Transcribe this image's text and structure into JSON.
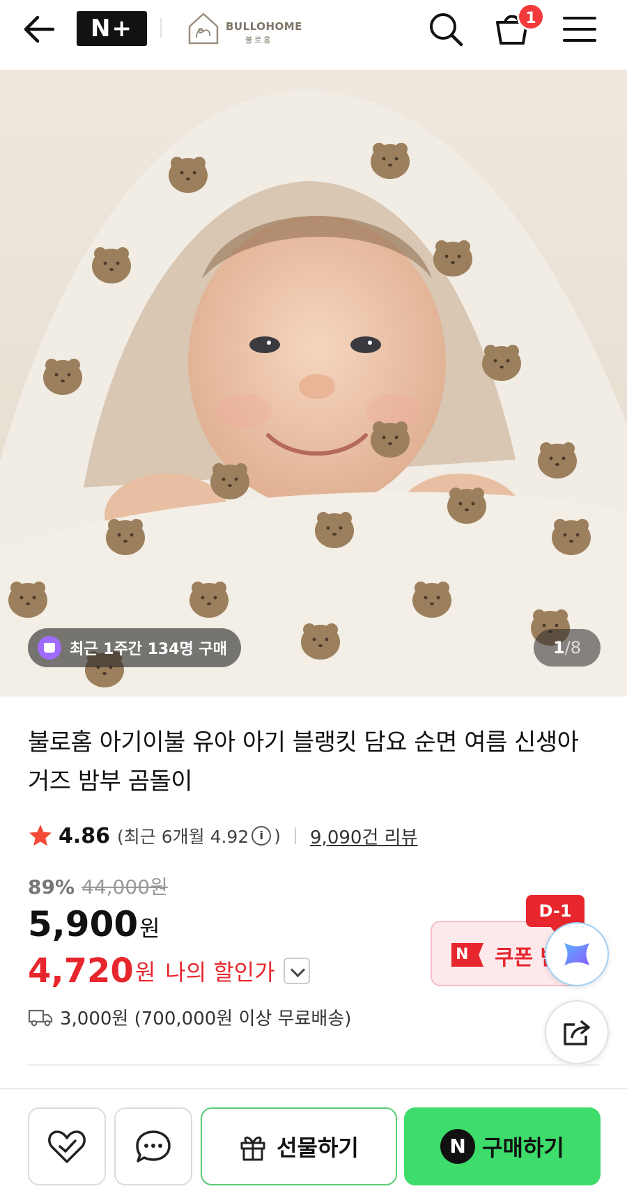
{
  "header": {
    "back_icon": "arrow-left-icon",
    "nplus_label": "N+",
    "brand_name": "BULLOHOME",
    "brand_sub": "불로홈",
    "search_icon": "search-icon",
    "cart_icon": "cart-icon",
    "cart_badge": "1",
    "menu_icon": "hamburger-menu-icon"
  },
  "hero": {
    "recent_purchase": "최근 1주간 134명 구매",
    "page_current": "1",
    "page_sep": "/",
    "page_total": "8"
  },
  "product": {
    "title": "불로홈 아기이불 유아 아기 블랭킷 담요 순면 여름 신생아 거즈 밤부 곰돌이",
    "rating": "4.86",
    "rating_recent": "(최근 6개월 4.92",
    "rating_recent_close": ")",
    "info_label": "i",
    "reviews": "9,090건 리뷰",
    "discount_pct": "89%",
    "original_price": "44,000원",
    "price": "5,900",
    "price_unit": "원",
    "my_price": "4,720",
    "my_price_unit": "원",
    "my_price_label": "나의 할인가",
    "shipping": "3,000원 (700,000원 이상 무료배송)"
  },
  "coupon": {
    "n_label": "N",
    "label": "쿠폰 받기",
    "dday": "D-1"
  },
  "bottom": {
    "gift_label": "선물하기",
    "buy_label": "구매하기",
    "buy_n": "N"
  },
  "colors": {
    "accent_red": "#e8262d",
    "buy_green": "#3ddc6b",
    "gift_border": "#57cc76"
  }
}
